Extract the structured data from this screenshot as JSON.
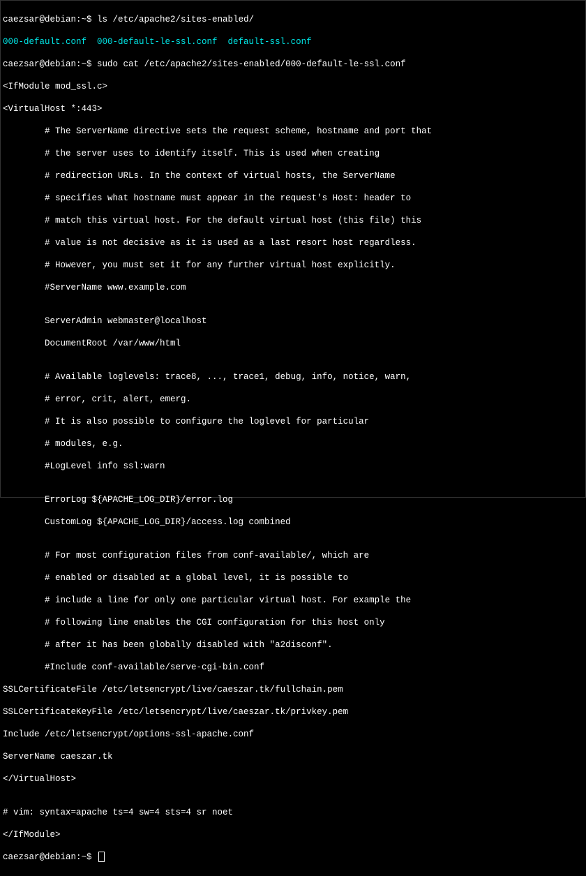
{
  "prompt1": {
    "userhost": "caezsar@debian:~$ ",
    "cmd": "ls /etc/apache2/sites-enabled/"
  },
  "ls_output": "000-default.conf  000-default-le-ssl.conf  default-ssl.conf",
  "prompt2": {
    "userhost": "caezsar@debian:~$ ",
    "cmd": "sudo cat /etc/apache2/sites-enabled/000-default-le-ssl.conf"
  },
  "file": {
    "l1": "<IfModule mod_ssl.c>",
    "l2": "<VirtualHost *:443>",
    "l3": "        # The ServerName directive sets the request scheme, hostname and port that",
    "l4": "        # the server uses to identify itself. This is used when creating",
    "l5": "        # redirection URLs. In the context of virtual hosts, the ServerName",
    "l6": "        # specifies what hostname must appear in the request's Host: header to",
    "l7": "        # match this virtual host. For the default virtual host (this file) this",
    "l8": "        # value is not decisive as it is used as a last resort host regardless.",
    "l9": "        # However, you must set it for any further virtual host explicitly.",
    "l10": "        #ServerName www.example.com",
    "l11": "",
    "l12": "        ServerAdmin webmaster@localhost",
    "l13": "        DocumentRoot /var/www/html",
    "l14": "",
    "l15": "        # Available loglevels: trace8, ..., trace1, debug, info, notice, warn,",
    "l16": "        # error, crit, alert, emerg.",
    "l17": "        # It is also possible to configure the loglevel for particular",
    "l18": "        # modules, e.g.",
    "l19": "        #LogLevel info ssl:warn",
    "l20": "",
    "l21": "        ErrorLog ${APACHE_LOG_DIR}/error.log",
    "l22": "        CustomLog ${APACHE_LOG_DIR}/access.log combined",
    "l23": "",
    "l24": "        # For most configuration files from conf-available/, which are",
    "l25": "        # enabled or disabled at a global level, it is possible to",
    "l26": "        # include a line for only one particular virtual host. For example the",
    "l27": "        # following line enables the CGI configuration for this host only",
    "l28": "        # after it has been globally disabled with \"a2disconf\".",
    "l29": "        #Include conf-available/serve-cgi-bin.conf",
    "l30": "SSLCertificateFile /etc/letsencrypt/live/caeszar.tk/fullchain.pem",
    "l31": "SSLCertificateKeyFile /etc/letsencrypt/live/caeszar.tk/privkey.pem",
    "l32": "Include /etc/letsencrypt/options-ssl-apache.conf",
    "l33": "ServerName caeszar.tk",
    "l34": "</VirtualHost>",
    "l35": "",
    "l36": "# vim: syntax=apache ts=4 sw=4 sts=4 sr noet",
    "l37": "</IfModule>"
  },
  "prompt3": {
    "userhost": "caezsar@debian:~$ "
  }
}
